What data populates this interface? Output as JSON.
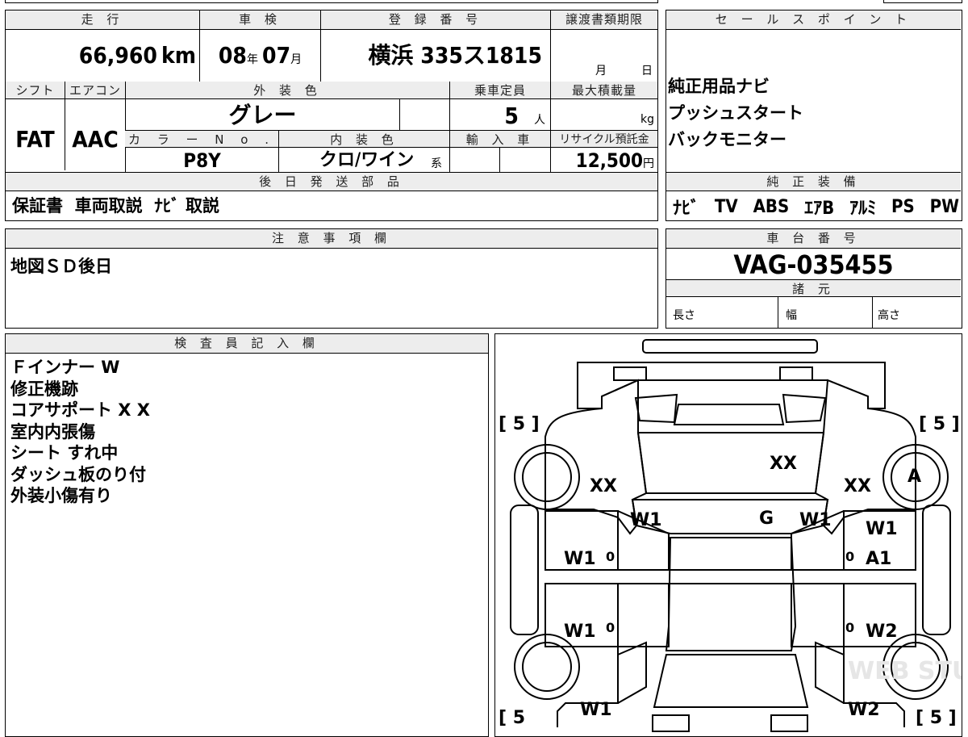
{
  "top_info": {
    "mileage": {
      "label": "走 行",
      "value": "66,960",
      "unit": "km"
    },
    "inspection": {
      "label": "車 検",
      "year": "08",
      "year_unit": "年",
      "month": "07",
      "month_unit": "月"
    },
    "registration": {
      "label": "登 録 番 号",
      "value": "横浜 335ス1815"
    },
    "transfer_deadline": {
      "label": "譲渡書類期限",
      "month_unit": "月",
      "day_unit": "日"
    },
    "shift": {
      "label": "シフト",
      "value": "FAT"
    },
    "aircon": {
      "label": "エアコン",
      "value": "AAC"
    },
    "exterior_color": {
      "label": "外 装 色",
      "value": "グレー"
    },
    "capacity": {
      "label": "乗車定員",
      "value": "5",
      "unit": "人"
    },
    "max_load": {
      "label": "最大積載量",
      "unit": "kg"
    },
    "color_no": {
      "label": "カ ラ ー N o .",
      "value": "P8Y"
    },
    "interior_color": {
      "label": "内 装 色",
      "value": "クロ/ワイン",
      "suffix": "系"
    },
    "import": {
      "label": "輸 入 車"
    },
    "recycle": {
      "label": "リサイクル預託金",
      "value": "12,500",
      "unit": "円"
    }
  },
  "later_parts": {
    "label": "後 日 発 送 部 品",
    "value": "保証書  車両取説  ﾅﾋﾞ 取説"
  },
  "sales_points": {
    "label": "セ ー ル ス ポ イ ン ト",
    "items": [
      "純正用品ナビ",
      "プッシュスタート",
      "バックモニター"
    ]
  },
  "genuine_equipment": {
    "label": "純 正 装 備",
    "items": [
      "ﾅﾋﾞ",
      "TV",
      "ABS",
      "ｴｱB",
      "ｱﾙﾐ",
      "PS",
      "PW"
    ]
  },
  "caution": {
    "label": "注 意 事 項 欄",
    "value": "地図ＳＤ後日"
  },
  "chassis": {
    "label": "車 台 番 号",
    "value": "VAG-035455"
  },
  "specs": {
    "label": "諸 元",
    "length": "長さ",
    "width": "幅",
    "height": "高さ"
  },
  "inspector_notes": {
    "label": "検 査 員 記 入 欄",
    "lines": [
      "Ｆインナー W",
      "修正機跡",
      "コアサポート X X",
      "室内内張傷",
      "シート すれ中",
      "ダッシュ板のり付",
      "外装小傷有り"
    ]
  },
  "diagram": {
    "tire_left_top": "[ 5 ]",
    "tire_right_top": "[ 5 ]",
    "tire_left_bottom": "[ 5",
    "tire_right_bottom": "[ 5 ]",
    "hood": "XX",
    "left_front_fender": "XX",
    "right_front_fender": "XX",
    "right_front_wheel": "A",
    "left_a_pillar": "W1",
    "right_a_pillar": "W1",
    "roof": "G",
    "right_front_upper": "W1",
    "left_front_door": "W1",
    "right_front_door": "A1",
    "left_rear_door": "W1",
    "right_rear_door": "W2",
    "left_rear_quarter": "W1",
    "right_rear_quarter": "W2",
    "zero_lf": "0",
    "zero_rf": "0",
    "zero_lr": "0",
    "zero_rr": "0",
    "watermark": "WEB STUDIO PRO"
  }
}
